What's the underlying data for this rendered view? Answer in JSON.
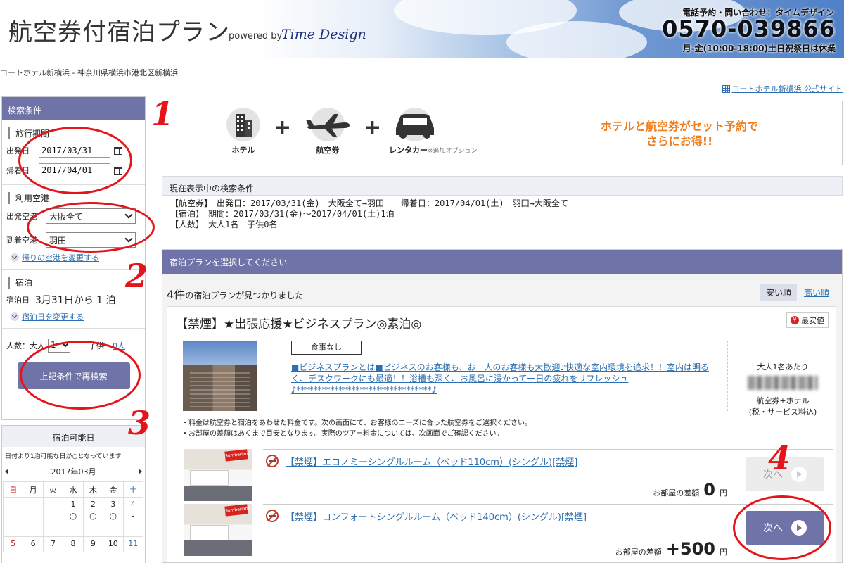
{
  "header": {
    "title": "航空券付宿泊プラン",
    "powered_by": "powered by",
    "brand": "Time Design",
    "contact_label": "電話予約・問い合わせ：タイムデザイン",
    "phone": "0570-039866",
    "hours": "月-金(10:00-18:00)土日祝祭日は休業"
  },
  "breadcrumb": "コートホテル新横浜 - 神奈川県横浜市港北区新横浜",
  "official_link": "コートホテル新横浜 公式サイト",
  "sidebar": {
    "header": "検索条件",
    "period_title": "旅行期間",
    "depart_label": "出発日",
    "depart_value": "2017/03/31",
    "return_label": "帰着日",
    "return_value": "2017/04/01",
    "airport_title": "利用空港",
    "depart_airport_label": "出発空港",
    "depart_airport_value": "大阪全て",
    "arrive_airport_label": "到着空港",
    "arrive_airport_value": "羽田",
    "change_return_airport": "帰りの空港を変更する",
    "stay_title": "宿泊",
    "stay_label": "宿泊日",
    "stay_value": "3月31日から 1 泊",
    "change_stay": "宿泊日を変更する",
    "adults_label": "人数：大人",
    "adults_value": "1",
    "children_label": "子供",
    "children_value": "0人",
    "research_button": "上記条件で再検索"
  },
  "availability": {
    "header": "宿泊可能日",
    "note": "日付より1泊可能な日が○となっています",
    "month": "2017年03月",
    "weekdays": [
      "日",
      "月",
      "火",
      "水",
      "木",
      "金",
      "土"
    ],
    "week1": [
      "",
      "",
      "",
      "1",
      "2",
      "3",
      "4"
    ],
    "week1_marks": [
      "",
      "",
      "",
      "○",
      "○",
      "○",
      "-"
    ],
    "week2": [
      "5",
      "6",
      "7",
      "8",
      "9",
      "10",
      "11"
    ]
  },
  "banner": {
    "hotel": "ホテル",
    "air": "航空券",
    "car": "レンタカー",
    "car_note": "※追加オプション",
    "plus": "+",
    "promo_line1": "ホテルと航空券がセット予約で",
    "promo_line2": "さらにお得!!"
  },
  "conditions": {
    "header": "現在表示中の検索条件",
    "line1": "【航空券】　出発日：2017/03/31(金)　大阪全て→羽田　　帰着日：2017/04/01(土)　羽田→大阪全て",
    "line2": "【宿泊】　期間：2017/03/31(金)～2017/04/01(土)1泊",
    "line3": "【人数】　大人1名　子供0名"
  },
  "plans": {
    "header": "宿泊プランを選択してください",
    "count": "4件",
    "found_text": "の宿泊プランが見つかりました",
    "sort_cheap": "安い順",
    "sort_expensive": "高い順",
    "plan_title": "【禁煙】★出張応援★ビジネスプラン◎素泊◎",
    "best_price": "最安値",
    "meal": "食事なし",
    "description": "■ビジネスプランとは■ビジネスのお客様も、お一人のお客様も大歓迎♪快適な室内環境を追求！！室内は明るく、デスクワークにも最適！！浴槽も深く、お風呂に浸かって一日の疲れをリフレッシュ♪********************************♪",
    "per_person": "大人1名あたり",
    "price_type_line1": "航空券+ホテル",
    "price_type_line2": "(税・サービス料込)",
    "note1": "・料金は航空券と宿泊をあわせた料金です。次の画面にて、お客様のニーズに合った航空券をご選択ください。",
    "note2": "・お部屋の差額はあくまで目安となります。実際のツアー料金については、次画面でご確認ください。",
    "rooms": [
      {
        "name": "【禁煙】エコノミーシングルルーム（ベッド110cm）(シングル)[禁煙]",
        "diff_label": "お部屋の差額",
        "diff_value": "0",
        "unit": "円",
        "button": "次へ"
      },
      {
        "name": "【禁煙】コンフォートシングルルーム（ベッド140cm）(シングル)[禁煙]",
        "diff_label": "お部屋の差額",
        "diff_value": "+500",
        "unit": "円",
        "button": "次へ"
      }
    ]
  },
  "annotations": [
    "1",
    "2",
    "3",
    "4"
  ],
  "colors": {
    "accent": "#6f73a7",
    "promo": "#ef7d1e",
    "annotation": "#e4141b",
    "link": "#2d6fb0"
  }
}
